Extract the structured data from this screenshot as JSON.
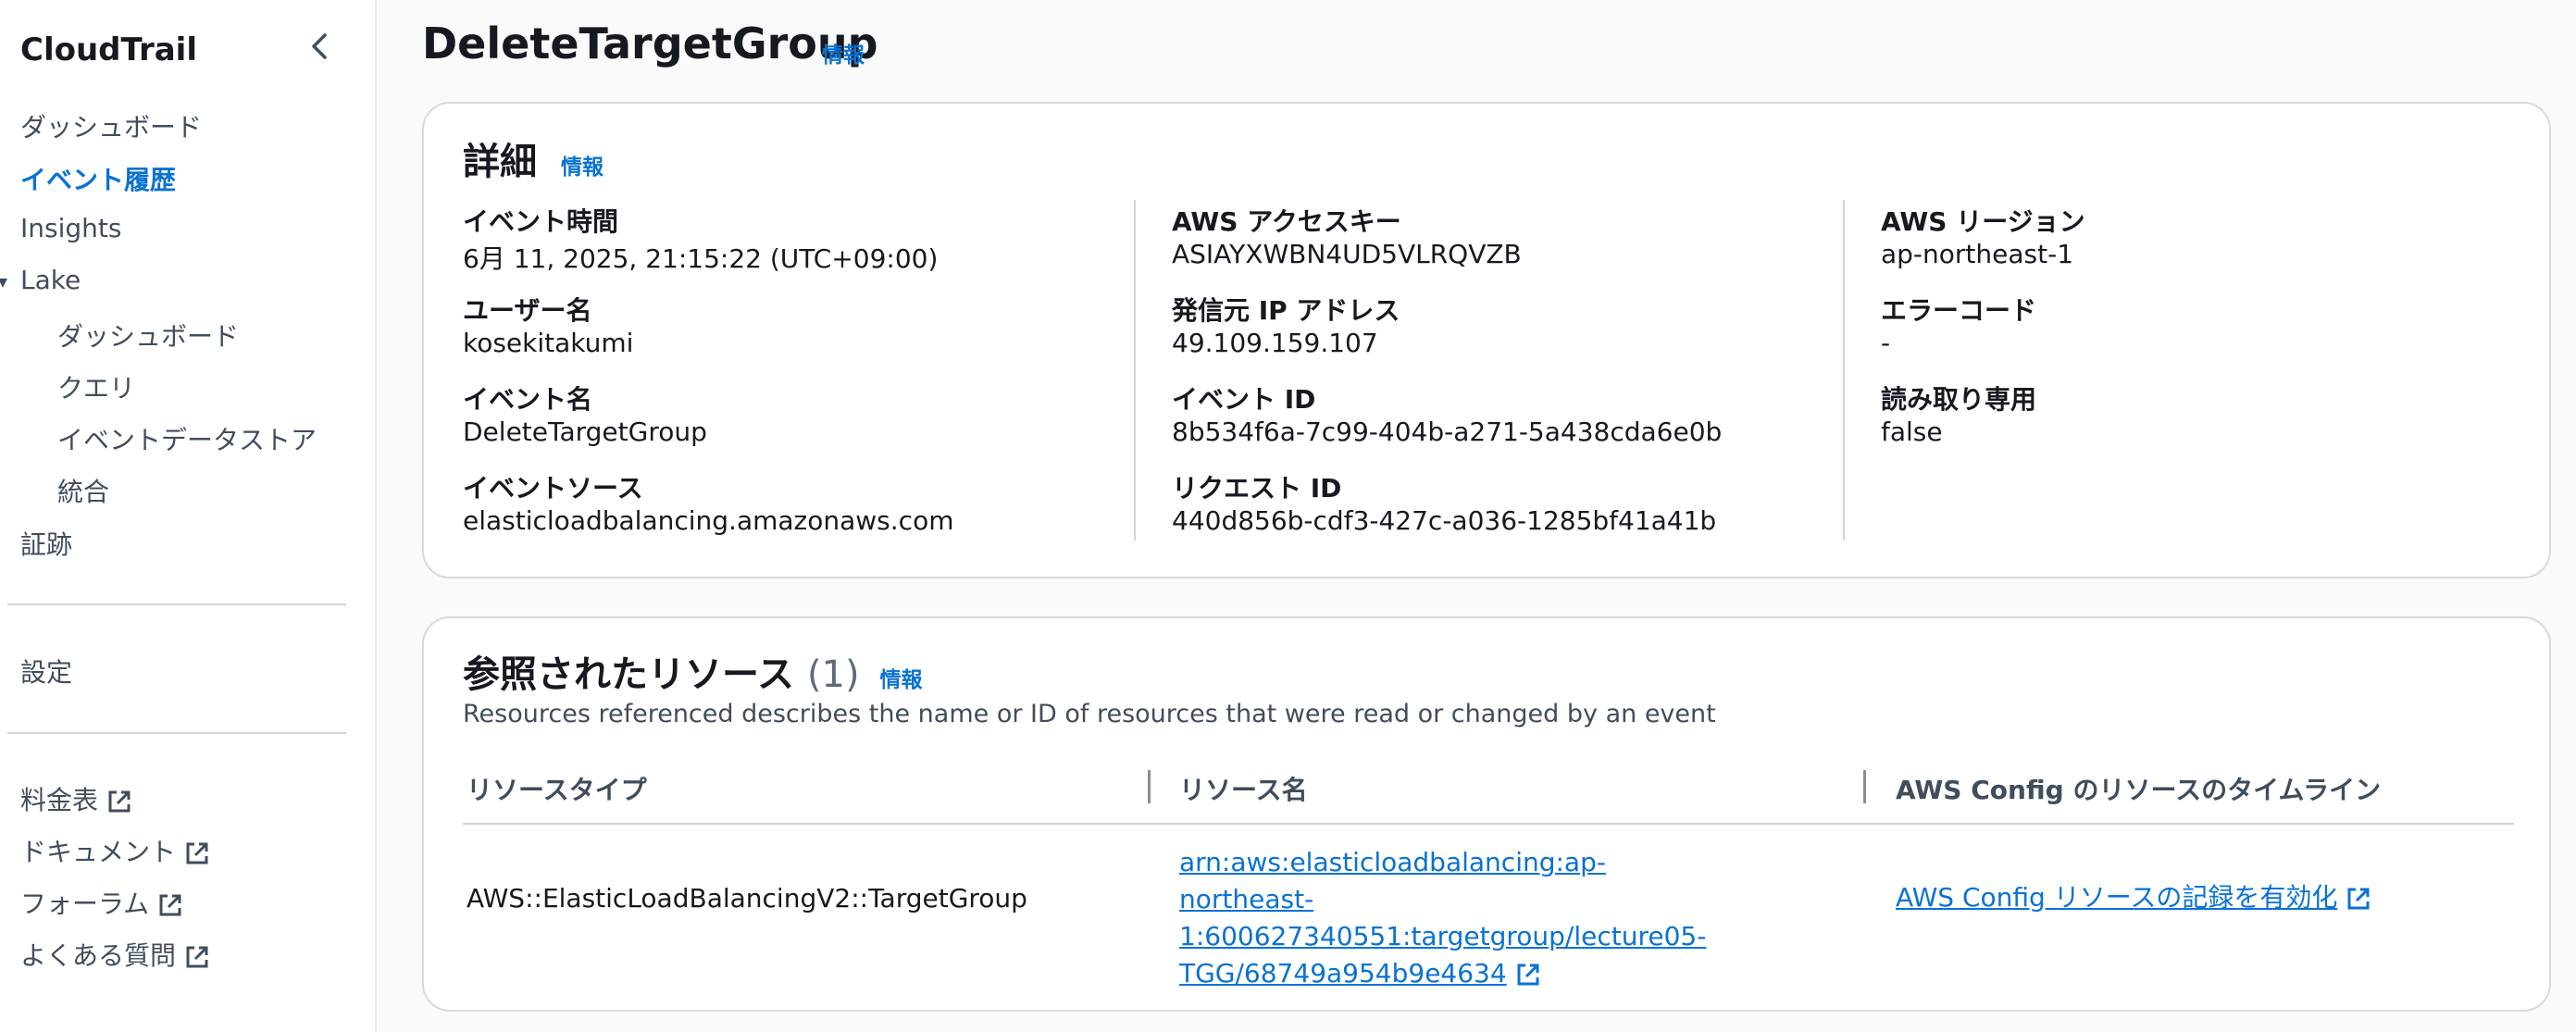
{
  "sidebar": {
    "title": "CloudTrail",
    "items": [
      {
        "label": "ダッシュボード"
      },
      {
        "label": "イベント履歴"
      },
      {
        "label": "Insights"
      },
      {
        "label": "Lake"
      },
      {
        "label": "ダッシュボード"
      },
      {
        "label": "クエリ"
      },
      {
        "label": "イベントデータストア"
      },
      {
        "label": "統合"
      },
      {
        "label": "証跡"
      },
      {
        "label": "設定"
      },
      {
        "label": "料金表"
      },
      {
        "label": "ドキュメント"
      },
      {
        "label": "フォーラム"
      },
      {
        "label": "よくある質問"
      }
    ]
  },
  "page": {
    "title": "DeleteTargetGroup",
    "info": "情報"
  },
  "details": {
    "heading": "詳細",
    "info": "情報",
    "col1": [
      {
        "label": "イベント時間",
        "value": "6月 11, 2025, 21:15:22 (UTC+09:00)"
      },
      {
        "label": "ユーザー名",
        "value": "kosekitakumi"
      },
      {
        "label": "イベント名",
        "value": "DeleteTargetGroup"
      },
      {
        "label": "イベントソース",
        "value": "elasticloadbalancing.amazonaws.com"
      }
    ],
    "col2": [
      {
        "label": "AWS アクセスキー",
        "value": "ASIAYXWBN4UD5VLRQVZB"
      },
      {
        "label": "発信元 IP アドレス",
        "value": "49.109.159.107"
      },
      {
        "label": "イベント ID",
        "value": "8b534f6a-7c99-404b-a271-5a438cda6e0b"
      },
      {
        "label": "リクエスト ID",
        "value": "440d856b-cdf3-427c-a036-1285bf41a41b"
      }
    ],
    "col3": [
      {
        "label": "AWS リージョン",
        "value": "ap-northeast-1"
      },
      {
        "label": "エラーコード",
        "value": "-"
      },
      {
        "label": "読み取り専用",
        "value": "false"
      }
    ]
  },
  "resources": {
    "heading": "参照されたリソース",
    "count": "(1)",
    "info": "情報",
    "description": "Resources referenced describes the name or ID of resources that were read or changed by an event",
    "columns": [
      "リソースタイプ",
      "リソース名",
      "AWS Config のリソースのタイムライン"
    ],
    "rows": [
      {
        "type": "AWS::ElasticLoadBalancingV2::TargetGroup",
        "name_lines": [
          "arn:aws:elasticloadbalancing:ap-northeast-",
          "1:600627340551:targetgroup/lecture05-",
          "TGG/68749a954b9e4634"
        ],
        "config_link": "AWS Config リソースの記録を有効化"
      }
    ]
  },
  "colors": {
    "accent": "#0972d3",
    "text": "#16191f",
    "muted": "#414d5c"
  }
}
